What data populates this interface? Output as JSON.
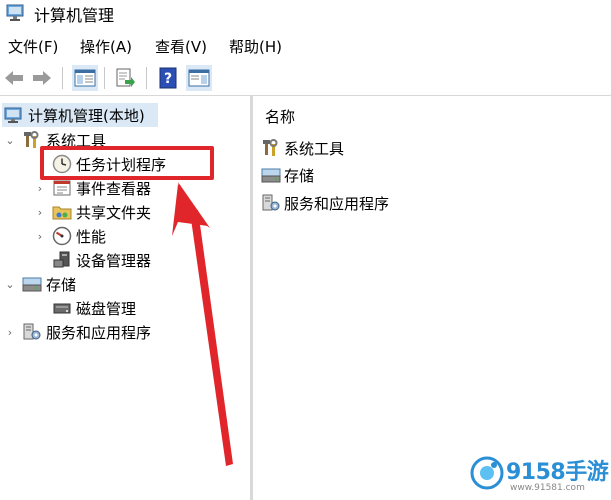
{
  "window": {
    "title": "计算机管理"
  },
  "menu": [
    {
      "label": "文件(F)"
    },
    {
      "label": "操作(A)"
    },
    {
      "label": "查看(V)"
    },
    {
      "label": "帮助(H)"
    }
  ],
  "tree": {
    "root": {
      "label": "计算机管理(本地)",
      "icon": "computer-management-icon"
    },
    "system_tools": {
      "label": "系统工具",
      "icon": "tools-icon",
      "expanded": true
    },
    "task_scheduler": {
      "label": "任务计划程序",
      "icon": "clock-icon"
    },
    "event_viewer": {
      "label": "事件查看器",
      "icon": "event-viewer-icon"
    },
    "shared_folders": {
      "label": "共享文件夹",
      "icon": "shared-folder-icon"
    },
    "performance": {
      "label": "性能",
      "icon": "performance-icon"
    },
    "device_manager": {
      "label": "设备管理器",
      "icon": "device-manager-icon"
    },
    "storage": {
      "label": "存储",
      "icon": "storage-icon",
      "expanded": true
    },
    "disk_management": {
      "label": "磁盘管理",
      "icon": "disk-icon"
    },
    "services": {
      "label": "服务和应用程序",
      "icon": "services-icon"
    }
  },
  "list": {
    "column_header": "名称",
    "items": [
      {
        "label": "系统工具",
        "icon": "tools-icon"
      },
      {
        "label": "存储",
        "icon": "storage-icon"
      },
      {
        "label": "服务和应用程序",
        "icon": "services-icon"
      }
    ]
  },
  "annotation": {
    "color": "#e0262b"
  },
  "watermark": {
    "brand": "9158手游",
    "url": "www.91581.com"
  }
}
